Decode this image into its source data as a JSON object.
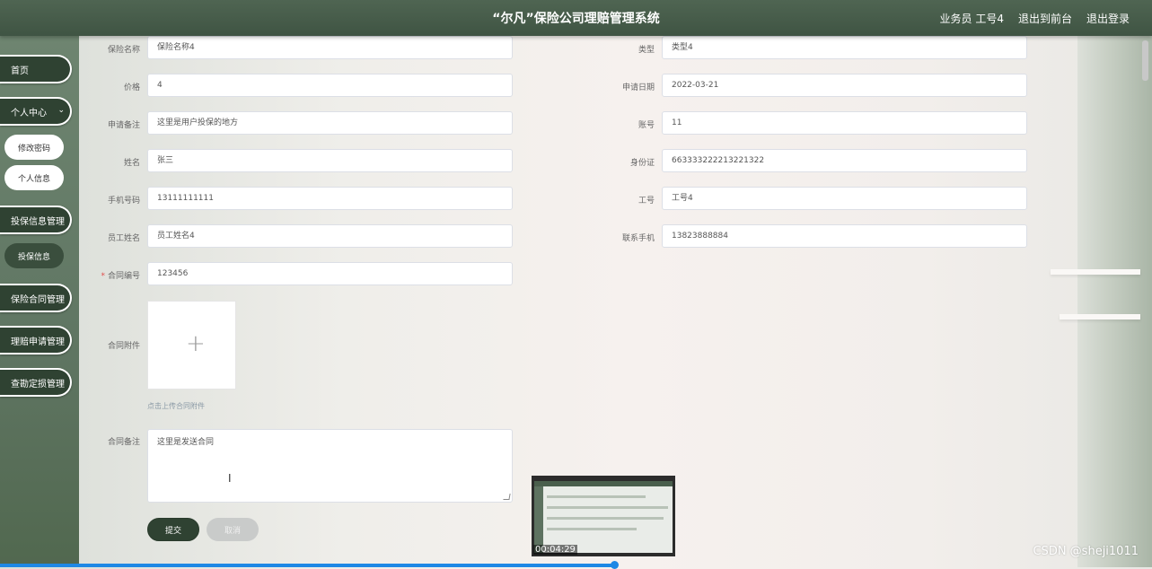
{
  "header": {
    "title": "“尔凡”保险公司理赔管理系统",
    "role": "业务员 工号4",
    "to_front": "退出到前台",
    "logout": "退出登录"
  },
  "sidebar": {
    "home": "首页",
    "personal_center": "个人中心",
    "change_password": "修改密码",
    "personal_info": "个人信息",
    "insurance_info_mgmt": "投保信息管理",
    "insurance_info": "投保信息",
    "contract_mgmt": "保险合同管理",
    "claim_mgmt": "理赔申请管理",
    "survey_mgmt": "查勘定损管理"
  },
  "form": {
    "insurance_name": {
      "label": "保险名称",
      "value": "保险名称4"
    },
    "type": {
      "label": "类型",
      "value": "类型4"
    },
    "price": {
      "label": "价格",
      "value": "4"
    },
    "apply_date": {
      "label": "申请日期",
      "value": "2022-03-21"
    },
    "apply_note": {
      "label": "申请备注",
      "value": "这里是用户投保的地方"
    },
    "account": {
      "label": "账号",
      "value": "11"
    },
    "name": {
      "label": "姓名",
      "value": "张三"
    },
    "id_card": {
      "label": "身份证",
      "value": "663333222213221322"
    },
    "phone": {
      "label": "手机号码",
      "value": "13111111111"
    },
    "staff_no": {
      "label": "工号",
      "value": "工号4"
    },
    "staff_name": {
      "label": "员工姓名",
      "value": "员工姓名4"
    },
    "contact_phone": {
      "label": "联系手机",
      "value": "13823888884"
    },
    "contract_no": {
      "label": "合同编号",
      "value": "123456",
      "required_mark": "*"
    },
    "contract_attachment": {
      "label": "合同附件",
      "hint": "点击上传合同附件"
    },
    "contract_note": {
      "label": "合同备注",
      "value": "这里是发送合同"
    },
    "submit": "提交",
    "cancel": "取消"
  },
  "video": {
    "timestamp": "00:04:29"
  },
  "watermark": "CSDN @sheji1011"
}
